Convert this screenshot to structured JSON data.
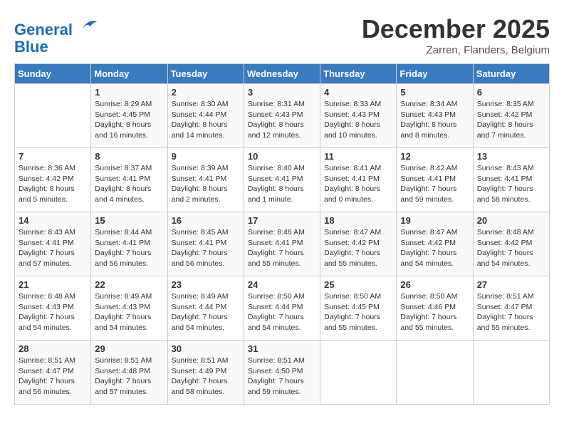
{
  "header": {
    "logo_line1": "General",
    "logo_line2": "Blue",
    "month": "December 2025",
    "location": "Zarren, Flanders, Belgium"
  },
  "weekdays": [
    "Sunday",
    "Monday",
    "Tuesday",
    "Wednesday",
    "Thursday",
    "Friday",
    "Saturday"
  ],
  "weeks": [
    [
      {
        "date": "",
        "info": ""
      },
      {
        "date": "1",
        "info": "Sunrise: 8:29 AM\nSunset: 4:45 PM\nDaylight: 8 hours\nand 16 minutes."
      },
      {
        "date": "2",
        "info": "Sunrise: 8:30 AM\nSunset: 4:44 PM\nDaylight: 8 hours\nand 14 minutes."
      },
      {
        "date": "3",
        "info": "Sunrise: 8:31 AM\nSunset: 4:43 PM\nDaylight: 8 hours\nand 12 minutes."
      },
      {
        "date": "4",
        "info": "Sunrise: 8:33 AM\nSunset: 4:43 PM\nDaylight: 8 hours\nand 10 minutes."
      },
      {
        "date": "5",
        "info": "Sunrise: 8:34 AM\nSunset: 4:43 PM\nDaylight: 8 hours\nand 8 minutes."
      },
      {
        "date": "6",
        "info": "Sunrise: 8:35 AM\nSunset: 4:42 PM\nDaylight: 8 hours\nand 7 minutes."
      }
    ],
    [
      {
        "date": "7",
        "info": "Sunrise: 8:36 AM\nSunset: 4:42 PM\nDaylight: 8 hours\nand 5 minutes."
      },
      {
        "date": "8",
        "info": "Sunrise: 8:37 AM\nSunset: 4:41 PM\nDaylight: 8 hours\nand 4 minutes."
      },
      {
        "date": "9",
        "info": "Sunrise: 8:39 AM\nSunset: 4:41 PM\nDaylight: 8 hours\nand 2 minutes."
      },
      {
        "date": "10",
        "info": "Sunrise: 8:40 AM\nSunset: 4:41 PM\nDaylight: 8 hours\nand 1 minute."
      },
      {
        "date": "11",
        "info": "Sunrise: 8:41 AM\nSunset: 4:41 PM\nDaylight: 8 hours\nand 0 minutes."
      },
      {
        "date": "12",
        "info": "Sunrise: 8:42 AM\nSunset: 4:41 PM\nDaylight: 7 hours\nand 59 minutes."
      },
      {
        "date": "13",
        "info": "Sunrise: 8:43 AM\nSunset: 4:41 PM\nDaylight: 7 hours\nand 58 minutes."
      }
    ],
    [
      {
        "date": "14",
        "info": "Sunrise: 8:43 AM\nSunset: 4:41 PM\nDaylight: 7 hours\nand 57 minutes."
      },
      {
        "date": "15",
        "info": "Sunrise: 8:44 AM\nSunset: 4:41 PM\nDaylight: 7 hours\nand 56 minutes."
      },
      {
        "date": "16",
        "info": "Sunrise: 8:45 AM\nSunset: 4:41 PM\nDaylight: 7 hours\nand 56 minutes."
      },
      {
        "date": "17",
        "info": "Sunrise: 8:46 AM\nSunset: 4:41 PM\nDaylight: 7 hours\nand 55 minutes."
      },
      {
        "date": "18",
        "info": "Sunrise: 8:47 AM\nSunset: 4:42 PM\nDaylight: 7 hours\nand 55 minutes."
      },
      {
        "date": "19",
        "info": "Sunrise: 8:47 AM\nSunset: 4:42 PM\nDaylight: 7 hours\nand 54 minutes."
      },
      {
        "date": "20",
        "info": "Sunrise: 8:48 AM\nSunset: 4:42 PM\nDaylight: 7 hours\nand 54 minutes."
      }
    ],
    [
      {
        "date": "21",
        "info": "Sunrise: 8:48 AM\nSunset: 4:43 PM\nDaylight: 7 hours\nand 54 minutes."
      },
      {
        "date": "22",
        "info": "Sunrise: 8:49 AM\nSunset: 4:43 PM\nDaylight: 7 hours\nand 54 minutes."
      },
      {
        "date": "23",
        "info": "Sunrise: 8:49 AM\nSunset: 4:44 PM\nDaylight: 7 hours\nand 54 minutes."
      },
      {
        "date": "24",
        "info": "Sunrise: 8:50 AM\nSunset: 4:44 PM\nDaylight: 7 hours\nand 54 minutes."
      },
      {
        "date": "25",
        "info": "Sunrise: 8:50 AM\nSunset: 4:45 PM\nDaylight: 7 hours\nand 55 minutes."
      },
      {
        "date": "26",
        "info": "Sunrise: 8:50 AM\nSunset: 4:46 PM\nDaylight: 7 hours\nand 55 minutes."
      },
      {
        "date": "27",
        "info": "Sunrise: 8:51 AM\nSunset: 4:47 PM\nDaylight: 7 hours\nand 55 minutes."
      }
    ],
    [
      {
        "date": "28",
        "info": "Sunrise: 8:51 AM\nSunset: 4:47 PM\nDaylight: 7 hours\nand 56 minutes."
      },
      {
        "date": "29",
        "info": "Sunrise: 8:51 AM\nSunset: 4:48 PM\nDaylight: 7 hours\nand 57 minutes."
      },
      {
        "date": "30",
        "info": "Sunrise: 8:51 AM\nSunset: 4:49 PM\nDaylight: 7 hours\nand 58 minutes."
      },
      {
        "date": "31",
        "info": "Sunrise: 8:51 AM\nSunset: 4:50 PM\nDaylight: 7 hours\nand 59 minutes."
      },
      {
        "date": "",
        "info": ""
      },
      {
        "date": "",
        "info": ""
      },
      {
        "date": "",
        "info": ""
      }
    ]
  ]
}
